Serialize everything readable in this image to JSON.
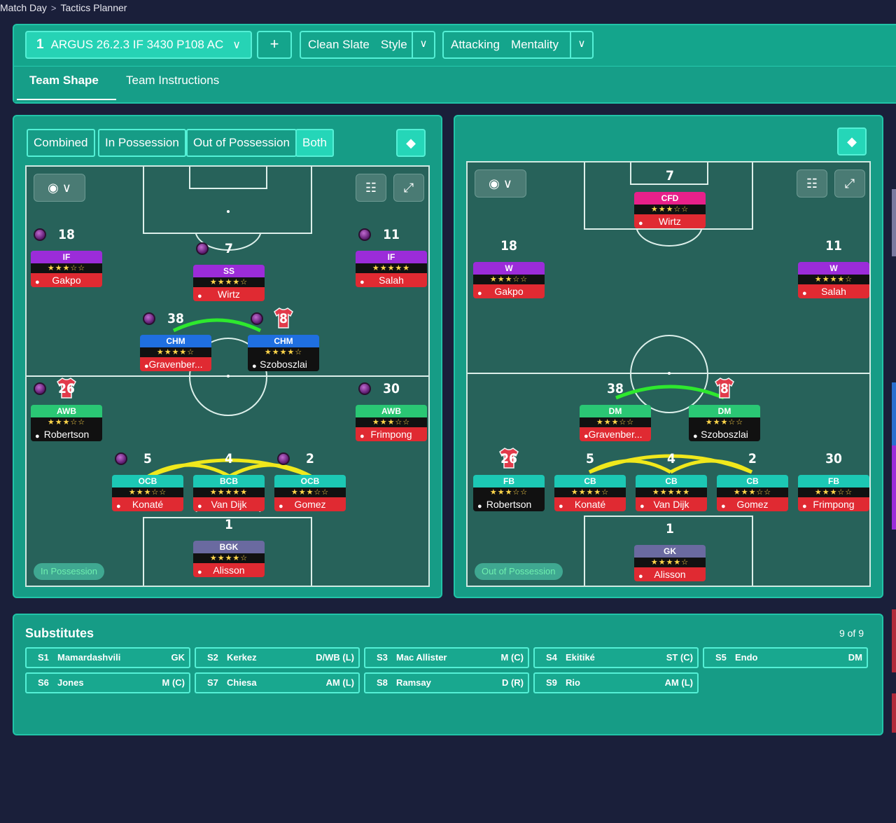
{
  "breadcrumb": {
    "parent": "Match Day",
    "separator": ">",
    "current": "Tactics Planner"
  },
  "tactic": {
    "number": "1",
    "name": "ARGUS 26.2.3 IF 3430 P108 AC",
    "add_label": "+",
    "style_value": "Clean Slate",
    "style_label": "Style",
    "mentality_value": "Attacking",
    "mentality_label": "Mentality"
  },
  "tabs": [
    "Team Shape",
    "Team Instructions"
  ],
  "view_filters": [
    "Combined",
    "In Possession",
    "Out of Possession",
    "Both"
  ],
  "left_pitch": {
    "mode_label": "In Possession",
    "players": [
      {
        "num": "18",
        "role": "IF",
        "stars": "★★★☆☆",
        "name": "Gakpo",
        "rc": "r-purple",
        "nc": "n-red",
        "bead": true
      },
      {
        "num": "7",
        "role": "SS",
        "stars": "★★★★☆",
        "name": "Wirtz",
        "rc": "r-purple",
        "nc": "n-red",
        "bead": true
      },
      {
        "num": "11",
        "role": "IF",
        "stars": "★★★★★",
        "name": "Salah",
        "rc": "r-purple",
        "nc": "n-red",
        "bead": true
      },
      {
        "num": "38",
        "role": "CHM",
        "stars": "★★★★☆",
        "name": "Gravenber...",
        "rc": "r-blue",
        "nc": "n-red",
        "bead": true
      },
      {
        "num": "8",
        "role": "CHM",
        "stars": "★★★★☆",
        "name": "Szoboszlai",
        "rc": "r-blue",
        "nc": "n-black",
        "bead": true,
        "shirt": true
      },
      {
        "num": "26",
        "role": "AWB",
        "stars": "★★★☆☆",
        "name": "Robertson",
        "rc": "r-green",
        "nc": "n-black",
        "bead": true,
        "shirt": true
      },
      {
        "num": "30",
        "role": "AWB",
        "stars": "★★★☆☆",
        "name": "Frimpong",
        "rc": "r-green",
        "nc": "n-red",
        "bead": true
      },
      {
        "num": "5",
        "role": "OCB",
        "stars": "★★★☆☆",
        "name": "Konaté",
        "rc": "r-teal",
        "nc": "n-red",
        "bead": true
      },
      {
        "num": "4",
        "role": "BCB",
        "stars": "★★★★★",
        "name": "Van Dijk",
        "rc": "r-teal",
        "nc": "n-red",
        "bead": false
      },
      {
        "num": "2",
        "role": "OCB",
        "stars": "★★★☆☆",
        "name": "Gomez",
        "rc": "r-teal",
        "nc": "n-red",
        "bead": true
      },
      {
        "num": "1",
        "role": "BGK",
        "stars": "★★★★☆",
        "name": "Alisson",
        "rc": "r-slate",
        "nc": "n-red",
        "bead": false
      }
    ]
  },
  "right_pitch": {
    "mode_label": "Out of Possession",
    "players": [
      {
        "num": "7",
        "role": "CFD",
        "stars": "★★★☆☆",
        "name": "Wirtz",
        "rc": "r-pink",
        "nc": "n-red"
      },
      {
        "num": "18",
        "role": "W",
        "stars": "★★★☆☆",
        "name": "Gakpo",
        "rc": "r-purple",
        "nc": "n-red"
      },
      {
        "num": "11",
        "role": "W",
        "stars": "★★★★☆",
        "name": "Salah",
        "rc": "r-purple",
        "nc": "n-red"
      },
      {
        "num": "38",
        "role": "DM",
        "stars": "★★★☆☆",
        "name": "Gravenber...",
        "rc": "r-green",
        "nc": "n-red"
      },
      {
        "num": "8",
        "role": "DM",
        "stars": "★★★☆☆",
        "name": "Szoboszlai",
        "rc": "r-green",
        "nc": "n-black",
        "shirt": true
      },
      {
        "num": "26",
        "role": "FB",
        "stars": "★★★☆☆",
        "name": "Robertson",
        "rc": "r-teal",
        "nc": "n-black",
        "shirt": true
      },
      {
        "num": "5",
        "role": "CB",
        "stars": "★★★★☆",
        "name": "Konaté",
        "rc": "r-teal",
        "nc": "n-red"
      },
      {
        "num": "4",
        "role": "CB",
        "stars": "★★★★★",
        "name": "Van Dijk",
        "rc": "r-teal",
        "nc": "n-red"
      },
      {
        "num": "2",
        "role": "CB",
        "stars": "★★★☆☆",
        "name": "Gomez",
        "rc": "r-teal",
        "nc": "n-red"
      },
      {
        "num": "30",
        "role": "FB",
        "stars": "★★★☆☆",
        "name": "Frimpong",
        "rc": "r-teal",
        "nc": "n-red"
      },
      {
        "num": "1",
        "role": "GK",
        "stars": "★★★★☆",
        "name": "Alisson",
        "rc": "r-slate",
        "nc": "n-red"
      }
    ]
  },
  "substitutes": {
    "title": "Substitutes",
    "count": "9 of 9",
    "items": [
      {
        "id": "S1",
        "name": "Mamardashvili",
        "pos": "GK"
      },
      {
        "id": "S2",
        "name": "Kerkez",
        "pos": "D/WB (L)"
      },
      {
        "id": "S3",
        "name": "Mac Allister",
        "pos": "M (C)"
      },
      {
        "id": "S4",
        "name": "Ekitiké",
        "pos": "ST (C)"
      },
      {
        "id": "S5",
        "name": "Endo",
        "pos": "DM"
      },
      {
        "id": "S6",
        "name": "Jones",
        "pos": "M (C)"
      },
      {
        "id": "S7",
        "name": "Chiesa",
        "pos": "AM (L)"
      },
      {
        "id": "S8",
        "name": "Ramsay",
        "pos": "D (R)"
      },
      {
        "id": "S9",
        "name": "Rio",
        "pos": "AM (L)"
      }
    ]
  },
  "icons": {
    "chevron": "chevron-down-icon",
    "eye": "eye-icon",
    "grid": "grid-icon",
    "expand": "expand-icon",
    "diamond": "diamond-icon",
    "person": "person-icon"
  },
  "colors": {
    "accent": "#26d3b5",
    "panel": "#169c86",
    "background": "#1a1f3a"
  }
}
